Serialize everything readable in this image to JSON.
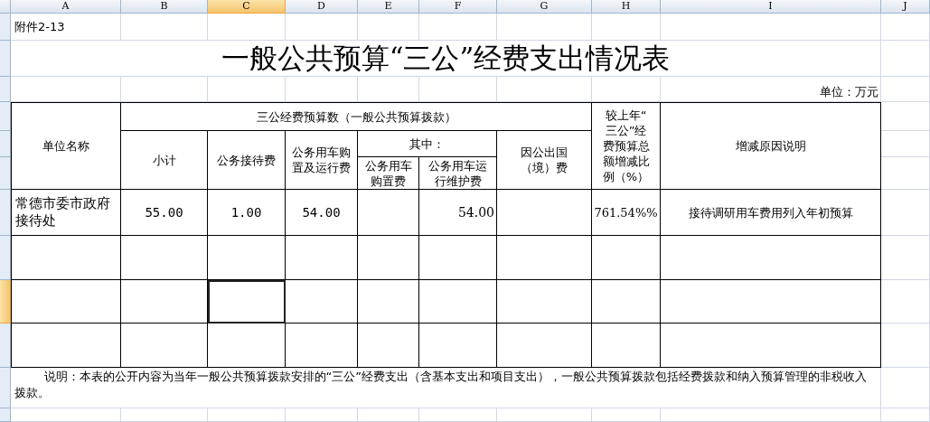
{
  "column_headers": [
    {
      "label": "A",
      "selected": false
    },
    {
      "label": "B",
      "selected": false
    },
    {
      "label": "C",
      "selected": true
    },
    {
      "label": "D",
      "selected": false
    },
    {
      "label": "E",
      "selected": false
    },
    {
      "label": "F",
      "selected": false
    },
    {
      "label": "G",
      "selected": false
    },
    {
      "label": "H",
      "selected": false
    },
    {
      "label": "I",
      "selected": false
    },
    {
      "label": "J",
      "selected": false
    }
  ],
  "row_headers": [
    {
      "selected": false
    },
    {
      "selected": false
    },
    {
      "selected": false
    },
    {
      "selected": false
    },
    {
      "selected": false
    },
    {
      "selected": false
    },
    {
      "selected": false
    },
    {
      "selected": false
    },
    {
      "selected": true
    },
    {
      "selected": false
    },
    {
      "selected": false
    },
    {
      "selected": false
    }
  ],
  "attachment": "附件2-13",
  "title": "一般公共预算“三公”经费支出情况表",
  "unit": "单位：万元",
  "header": {
    "unit_name": "单位名称",
    "budget_group": "三公经费预算数（一般公共预算拨款）",
    "subtotal": "小计",
    "reception": "公务接待费",
    "vehicle": "公务用车购置及运行费",
    "among": "其中：",
    "vehicle_purchase": "公务用车购置费",
    "vehicle_maintenance": "公务用车运行维护费",
    "abroad": "因公出国（境）费",
    "change_ratio": "较上年“三公”经费预算总额增减比例（%）",
    "reason": "增减原因说明"
  },
  "rows": [
    {
      "cells": [
        {
          "text": "常德市委市政府接待处",
          "selected": false
        },
        {
          "text": "55.00",
          "selected": false
        },
        {
          "text": "1.00",
          "selected": false
        },
        {
          "text": "54.00",
          "selected": false
        },
        {
          "selected": false
        },
        {
          "text": "54.00",
          "selected": false
        },
        {
          "selected": false
        },
        {
          "text": "761.54%%",
          "selected": false
        },
        {
          "text": "接待调研用车费用列入年初预算",
          "selected": false
        }
      ]
    },
    {
      "cells": [
        {
          "selected": false
        },
        {
          "selected": false
        },
        {
          "selected": false
        },
        {
          "selected": false
        },
        {
          "selected": false
        },
        {
          "selected": false
        },
        {
          "selected": false
        },
        {
          "selected": false
        },
        {
          "selected": false
        }
      ]
    },
    {
      "cells": [
        {
          "selected": false
        },
        {
          "selected": false
        },
        {
          "selected": true
        },
        {
          "selected": false
        },
        {
          "selected": false
        },
        {
          "selected": false
        },
        {
          "selected": false
        },
        {
          "selected": false
        },
        {
          "selected": false
        }
      ]
    },
    {
      "cells": [
        {
          "selected": false
        },
        {
          "selected": false
        },
        {
          "selected": false
        },
        {
          "selected": false
        },
        {
          "selected": false
        },
        {
          "selected": false
        },
        {
          "selected": false
        },
        {
          "selected": false
        },
        {
          "selected": false
        }
      ]
    }
  ],
  "note": "说明：本表的公开内容为当年一般公共预算拨款安排的“三公”经费支出（含基本支出和项目支出），一般公共预算拨款包括经费拨款和纳入预算管理的非税收入拨款。"
}
